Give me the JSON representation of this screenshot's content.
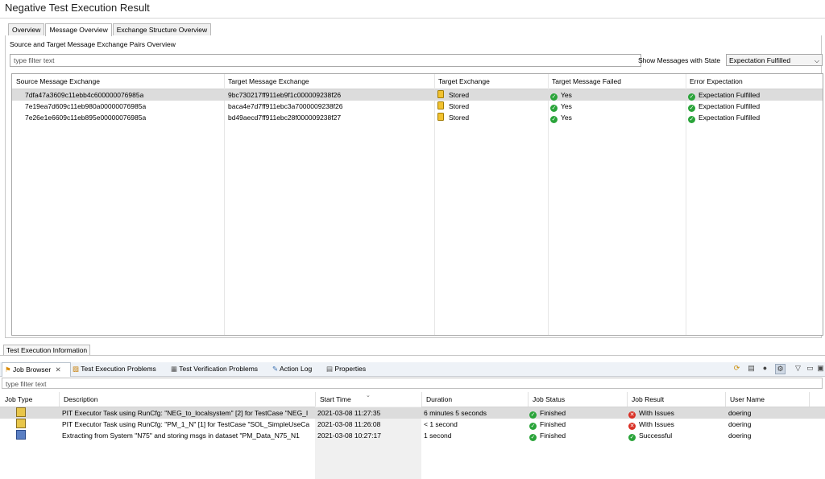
{
  "title": "Negative Test Execution Result",
  "tabs": [
    "Overview",
    "Message Overview",
    "Exchange Structure Overview"
  ],
  "active_tab": 1,
  "subtitle": "Source and Target Message Exchange Pairs Overview",
  "filter": {
    "placeholder": "type filter text"
  },
  "state_filter": {
    "label": "Show Messages with State",
    "selected": "Expectation Fulfilled"
  },
  "pairs_table": {
    "columns": [
      "Source Message Exchange",
      "Target Message Exchange",
      "Target Exchange",
      "Target Message Failed",
      "Error Expectation"
    ],
    "rows": [
      {
        "source": "7dfa47a3609c11ebb4c600000076985a",
        "target": "9bc730217ff911eb9f1c000009238f26",
        "target_exchange": "Stored",
        "failed": "Yes",
        "expectation": "Expectation Fulfilled"
      },
      {
        "source": "7e19ea7d609c11eb980a00000076985a",
        "target": "baca4e7d7ff911ebc3a7000009238f26",
        "target_exchange": "Stored",
        "failed": "Yes",
        "expectation": "Expectation Fulfilled"
      },
      {
        "source": "7e26e1e6609c11eb895e00000076985a",
        "target": "bd49aecd7ff911ebc28f000009238f27",
        "target_exchange": "Stored",
        "failed": "Yes",
        "expectation": "Expectation Fulfilled"
      }
    ]
  },
  "info_tab": "Test Execution Information",
  "bottom_tabs": [
    "Job Browser",
    "Test Execution Problems",
    "Test Verification Problems",
    "Action Log",
    "Properties"
  ],
  "job_filter": {
    "placeholder": "type filter text"
  },
  "jobs_table": {
    "columns": [
      "Job Type",
      "Description",
      "Start Time",
      "Duration",
      "Job Status",
      "Job Result",
      "User Name"
    ],
    "rows": [
      {
        "description": "PIT Executor Task using RunCfg: \"NEG_to_localsystem\" [2] for TestCase \"NEG_I",
        "start": "2021-03-08 11:27:35",
        "duration": "6 minutes 5 seconds",
        "status": "Finished",
        "result": "With Issues",
        "result_type": "error",
        "user": "doering"
      },
      {
        "description": "PIT Executor Task using RunCfg: \"PM_1_N\" [1] for TestCase \"SOL_SimpleUseCa",
        "start": "2021-03-08 11:26:08",
        "duration": "< 1 second",
        "status": "Finished",
        "result": "With Issues",
        "result_type": "error",
        "user": "doering"
      },
      {
        "description": "Extracting from System \"N75\" and storing msgs in dataset \"PM_Data_N75_N1",
        "start": "2021-03-08 10:27:17",
        "duration": "1 second",
        "status": "Finished",
        "result": "Successful",
        "result_type": "ok",
        "user": "doering"
      }
    ]
  },
  "colors": {
    "ok": "#2aa43a",
    "error": "#d93025",
    "selected_row": "#dcdcdc",
    "tabbar": "#eef2f7"
  }
}
